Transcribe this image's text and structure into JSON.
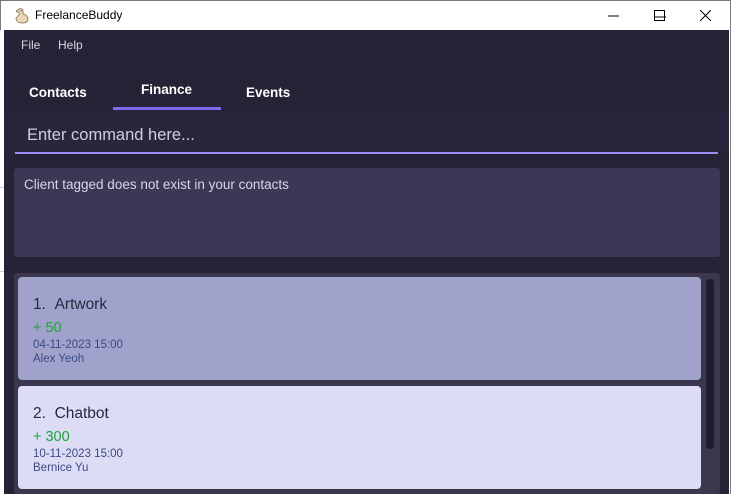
{
  "window": {
    "title": "FreelanceBuddy",
    "controls": [
      "minimize",
      "maximize",
      "close"
    ]
  },
  "menu": {
    "items": [
      {
        "label": "File"
      },
      {
        "label": "Help"
      }
    ]
  },
  "tabs": [
    {
      "label": "Contacts",
      "selected": false
    },
    {
      "label": "Finance",
      "selected": true
    },
    {
      "label": "Events",
      "selected": false
    }
  ],
  "command": {
    "placeholder": "Enter command here...",
    "value": ""
  },
  "result": {
    "message": "Client tagged does not exist in your contacts"
  },
  "finance_list": [
    {
      "index": "1.",
      "title": "Artwork",
      "amount": "+ 50",
      "datetime": "04-11-2023 15:00",
      "client": "Alex Yeoh"
    },
    {
      "index": "2.",
      "title": "Chatbot",
      "amount": "+ 300",
      "datetime": "10-11-2023 15:00",
      "client": "Bernice Yu"
    }
  ],
  "colors": {
    "background": "#262336",
    "accent": "#7d6af0",
    "card_selected": "#a1a2cb",
    "card_default": "#dcdcf4",
    "amount_positive": "#1ea43a",
    "result_box": "#3b3856"
  }
}
